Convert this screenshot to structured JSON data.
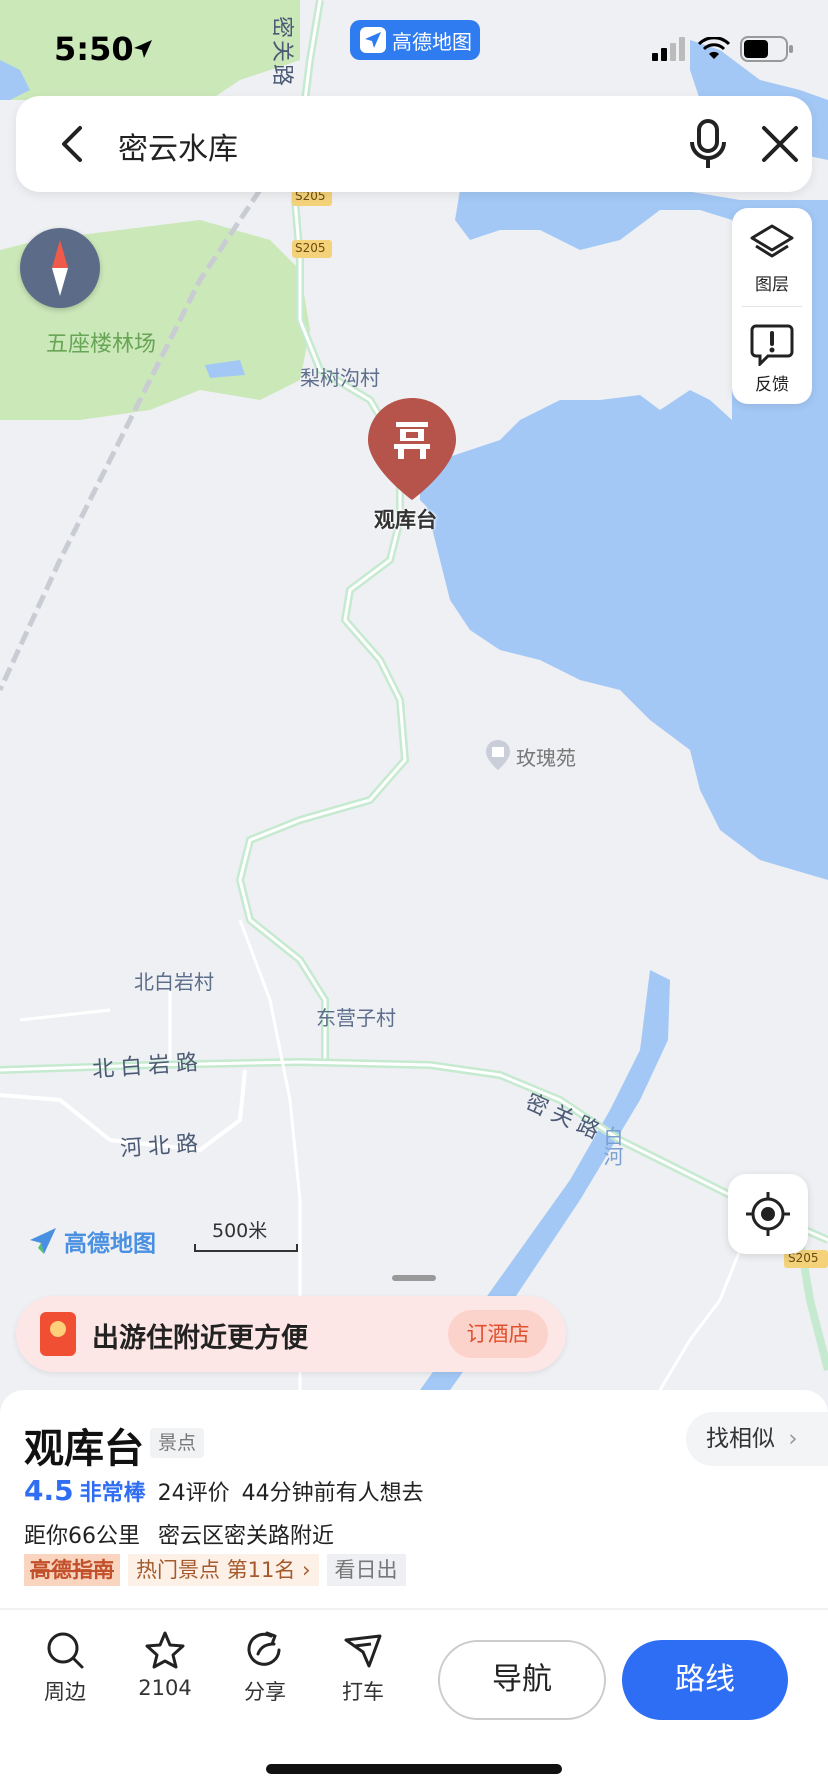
{
  "status": {
    "time": "5:50"
  },
  "top_badge": {
    "label": "高德地图"
  },
  "search": {
    "query": "密云水库"
  },
  "tools": {
    "layers_label": "图层",
    "feedback_label": "反馈"
  },
  "map": {
    "labels": {
      "forest": "五座楼林场",
      "village1": "梨树沟村",
      "village2": "北白岩村",
      "village3": "东营子村",
      "poi": "玫瑰苑",
      "road1": "北白岩路",
      "road2": "河北路",
      "road3": "密关路",
      "road_top": "密关路",
      "river": "白河",
      "s205": "S205"
    },
    "pin_label": "观库台",
    "logo_text": "高德地图",
    "scale_text": "500米"
  },
  "promo": {
    "text": "出游住附近更方便",
    "button": "订酒店"
  },
  "place": {
    "name": "观库台",
    "tag": "景点",
    "similar_label": "找相似",
    "rating": "4.5",
    "rating_word": "非常棒",
    "reviews": "24评价",
    "recent": "44分钟前有人想去",
    "distance": "距你66公里",
    "address": "密云区密关路附近",
    "guide_badge": "高德指南",
    "rank": "热门景点 第11名",
    "feature": "看日出"
  },
  "actions": {
    "nearby": "周边",
    "favorites": "2104",
    "share": "分享",
    "taxi": "打车",
    "navigate": "导航",
    "route": "路线"
  },
  "colors": {
    "water": "#a3c8f5",
    "green": "#cbe8b9",
    "road": "#c6ead0",
    "accent": "#2e6ef5",
    "pin": "#b6534a"
  }
}
